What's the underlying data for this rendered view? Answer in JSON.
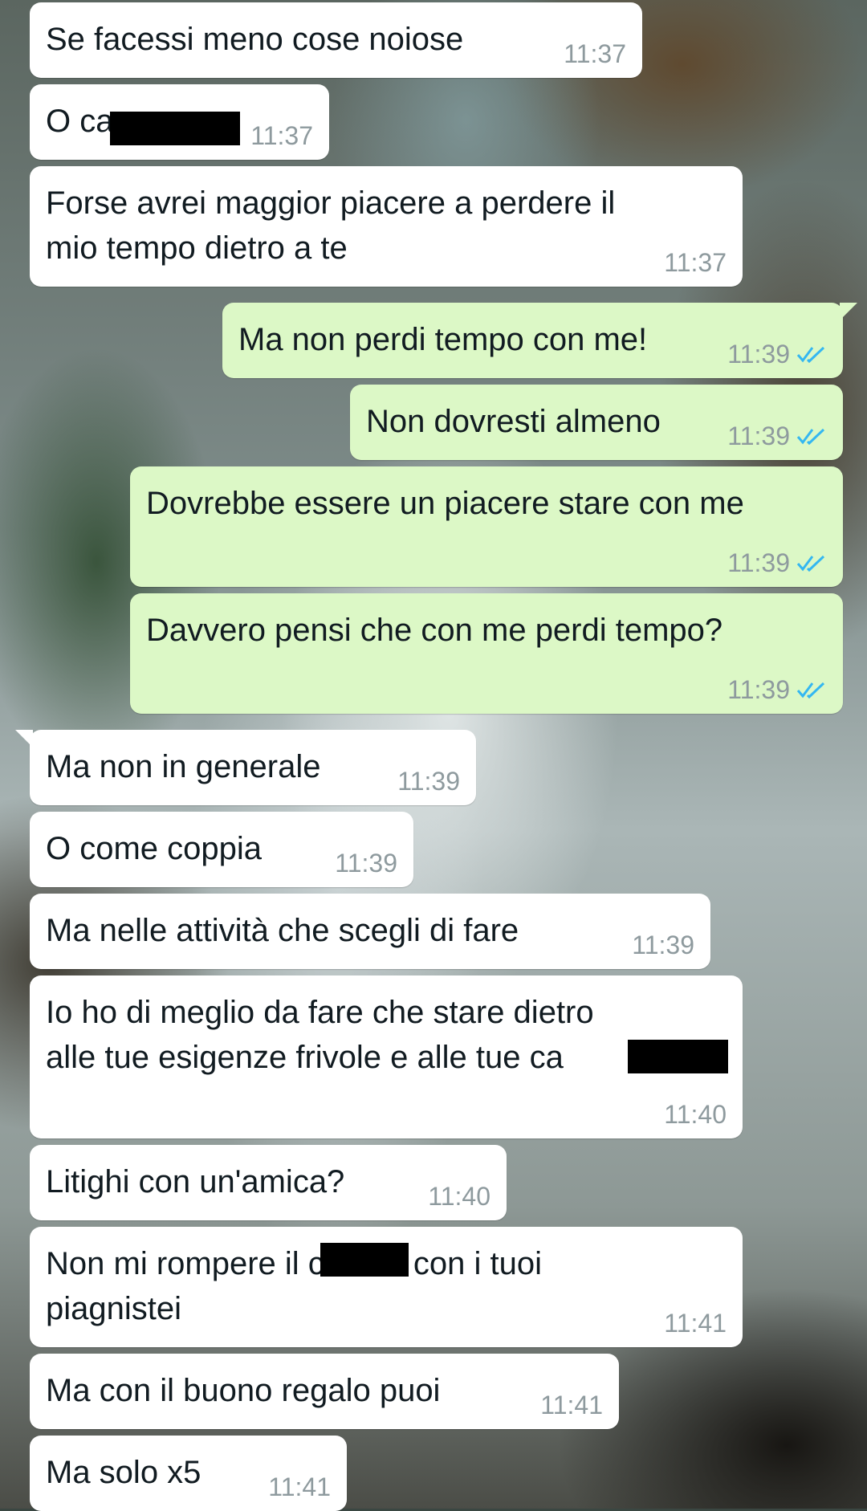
{
  "colors": {
    "incoming_bubble": "#ffffff",
    "outgoing_bubble": "#dcf8c6",
    "timestamp": "#8e9a9e",
    "read_ticks": "#34b7f1"
  },
  "messages": [
    {
      "dir": "in",
      "text": "Se facessi meno cose noiose",
      "time": "11:37"
    },
    {
      "dir": "in",
      "text": "O ca",
      "time": "11:37",
      "redacted": true
    },
    {
      "dir": "in",
      "text": "Forse avrei maggior piacere a perdere il\nmio tempo dietro a te",
      "time": "11:37"
    },
    {
      "dir": "out",
      "text": "Ma non perdi tempo con me!",
      "time": "11:39",
      "status_icon": "double-check-read-icon"
    },
    {
      "dir": "out",
      "text": "Non dovresti almeno",
      "time": "11:39",
      "status_icon": "double-check-read-icon"
    },
    {
      "dir": "out",
      "text": "Dovrebbe essere un piacere stare con me",
      "time": "11:39",
      "status_icon": "double-check-read-icon"
    },
    {
      "dir": "out",
      "text": "Davvero pensi che con me perdi tempo?",
      "time": "11:39",
      "status_icon": "double-check-read-icon"
    },
    {
      "dir": "in",
      "text": "Ma non in generale",
      "time": "11:39"
    },
    {
      "dir": "in",
      "text": "O come coppia",
      "time": "11:39"
    },
    {
      "dir": "in",
      "text": "Ma nelle attività che scegli di fare",
      "time": "11:39"
    },
    {
      "dir": "in",
      "text": "Io ho di meglio da fare che stare dietro\nalle tue esigenze frivole e alle tue ca",
      "time": "11:40",
      "redacted": true
    },
    {
      "dir": "in",
      "text": "Litighi con un'amica?",
      "time": "11:40"
    },
    {
      "dir": "in",
      "text": "Non mi rompere il c          con i tuoi\npiagnistei",
      "time": "11:41",
      "redacted": true
    },
    {
      "dir": "in",
      "text": "Ma con il buono regalo puoi",
      "time": "11:41"
    },
    {
      "dir": "in",
      "text": "Ma solo x5",
      "time": "11:41"
    }
  ]
}
